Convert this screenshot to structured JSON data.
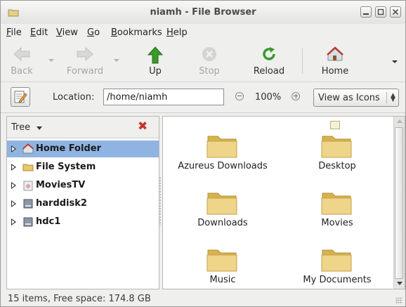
{
  "window": {
    "title": "niamh - File Browser",
    "controls": [
      "minimize-icon",
      "maximize-icon",
      "close-icon"
    ]
  },
  "menubar": {
    "items": [
      {
        "label": "File",
        "mnemonic": "F",
        "rest": "ile"
      },
      {
        "label": "Edit",
        "mnemonic": "E",
        "rest": "dit"
      },
      {
        "label": "View",
        "mnemonic": "V",
        "rest": "iew"
      },
      {
        "label": "Go",
        "mnemonic": "G",
        "rest": "o"
      },
      {
        "label": "Bookmarks",
        "mnemonic": "B",
        "rest": "ookmarks"
      },
      {
        "label": "Help",
        "mnemonic": "H",
        "rest": "elp"
      }
    ]
  },
  "toolbar": {
    "back": {
      "label": "Back",
      "icon": "back-arrow-icon",
      "enabled": false
    },
    "forward": {
      "label": "Forward",
      "icon": "forward-arrow-icon",
      "enabled": false
    },
    "up": {
      "label": "Up",
      "icon": "up-arrow-icon",
      "enabled": true
    },
    "stop": {
      "label": "Stop",
      "icon": "stop-icon",
      "enabled": false
    },
    "reload": {
      "label": "Reload",
      "icon": "reload-icon",
      "enabled": true
    },
    "home": {
      "label": "Home",
      "icon": "home-icon",
      "enabled": true
    }
  },
  "locationbar": {
    "label": "Location:",
    "value": "/home/niamh",
    "zoom": "100%",
    "view_mode": "View as Icons"
  },
  "sidepane": {
    "mode": "Tree",
    "items": [
      {
        "label": "Home Folder",
        "icon": "home-folder-icon",
        "selected": true
      },
      {
        "label": "File System",
        "icon": "filesystem-folder-icon",
        "selected": false
      },
      {
        "label": "MoviesTV",
        "icon": "disk-icon",
        "selected": false
      },
      {
        "label": "harddisk2",
        "icon": "harddisk-icon",
        "selected": false
      },
      {
        "label": "hdc1",
        "icon": "harddisk-icon",
        "selected": false
      }
    ]
  },
  "files": [
    {
      "name": "Azureus Downloads",
      "icon": "folder-icon"
    },
    {
      "name": "Desktop",
      "icon": "folder-icon"
    },
    {
      "name": "Downloads",
      "icon": "folder-icon"
    },
    {
      "name": "Movies",
      "icon": "folder-icon"
    },
    {
      "name": "Music",
      "icon": "folder-icon"
    },
    {
      "name": "My Documents",
      "icon": "folder-icon"
    }
  ],
  "status": {
    "text": "15 items, Free space: 174.8 GB"
  },
  "colors": {
    "selection": "#8fb4e2",
    "folder": "#e8c96a",
    "up_arrow": "#3a9a2a",
    "close_x": "#c7342b"
  }
}
